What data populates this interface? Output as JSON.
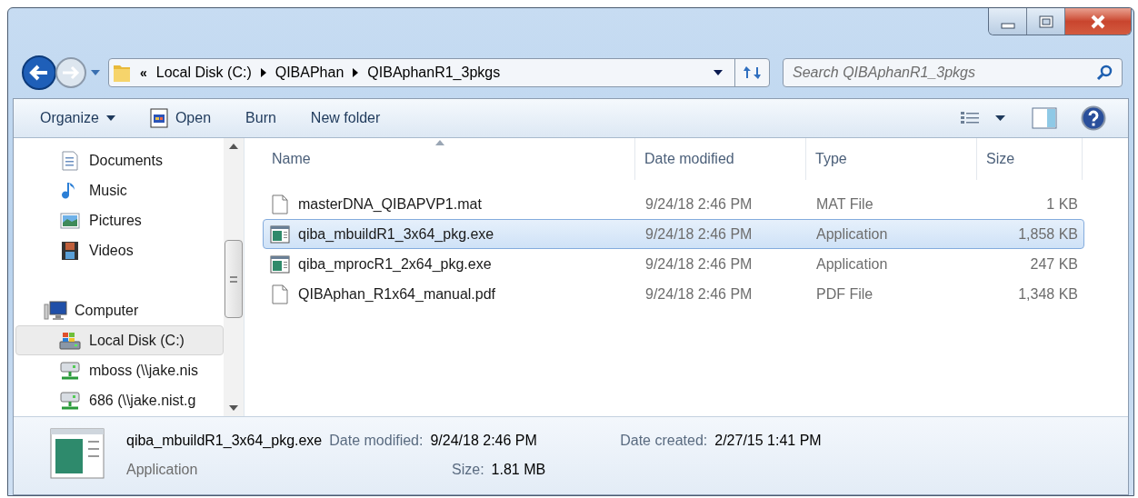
{
  "window_controls": [
    {
      "kind": "minimize"
    },
    {
      "kind": "maximize"
    },
    {
      "kind": "close"
    }
  ],
  "address": {
    "overflow": "«",
    "crumbs": [
      "Local Disk (C:)",
      "QIBAPhan",
      "QIBAphanR1_3pkgs"
    ]
  },
  "search": {
    "placeholder": "Search QIBAphanR1_3pkgs"
  },
  "toolbar": [
    {
      "label": "Organize",
      "kind": "menu"
    },
    {
      "label": "Open",
      "kind": "icon"
    },
    {
      "label": "Burn",
      "kind": "plain"
    },
    {
      "label": "New folder",
      "kind": "plain"
    }
  ],
  "sidebar": {
    "items": [
      {
        "label": "Documents",
        "kind": "documents",
        "selected": false
      },
      {
        "label": "Music",
        "kind": "music",
        "selected": false
      },
      {
        "label": "Pictures",
        "kind": "pictures",
        "selected": false
      },
      {
        "label": "Videos",
        "kind": "videos",
        "selected": false
      },
      {
        "label": "Computer",
        "kind": "computer",
        "selected": false,
        "children": [
          {
            "label": "Local Disk (C:)",
            "kind": "drive",
            "selected": true
          },
          {
            "label": "mboss (\\\\jake.nis",
            "kind": "network",
            "selected": false
          },
          {
            "label": "686 (\\\\jake.nist.g",
            "kind": "network",
            "selected": false
          }
        ]
      }
    ]
  },
  "table": {
    "columns": [
      "Name",
      "Date modified",
      "Type",
      "Size"
    ],
    "rows": [
      {
        "name": "masterDNA_QIBAPVP1.mat",
        "date": "9/24/18 2:46 PM",
        "type": "MAT File",
        "size": "1 KB",
        "kind": "file",
        "selected": false
      },
      {
        "name": "qiba_mbuildR1_3x64_pkg.exe",
        "date": "9/24/18 2:46 PM",
        "type": "Application",
        "size": "1,858 KB",
        "kind": "app",
        "selected": true
      },
      {
        "name": "qiba_mprocR1_2x64_pkg.exe",
        "date": "9/24/18 2:46 PM",
        "type": "Application",
        "size": "247 KB",
        "kind": "app",
        "selected": false
      },
      {
        "name": "QIBAphan_R1x64_manual.pdf",
        "date": "9/24/18 2:46 PM",
        "type": "PDF File",
        "size": "1,348 KB",
        "kind": "file",
        "selected": false
      }
    ]
  },
  "details": {
    "name": "qiba_mbuildR1_3x64_pkg.exe",
    "type": "Application",
    "modified_label": "Date modified:",
    "modified": "9/24/18 2:46 PM",
    "size_label": "Size:",
    "size": "1.81 MB",
    "created_label": "Date created:",
    "created": "2/27/15 1:41 PM"
  }
}
